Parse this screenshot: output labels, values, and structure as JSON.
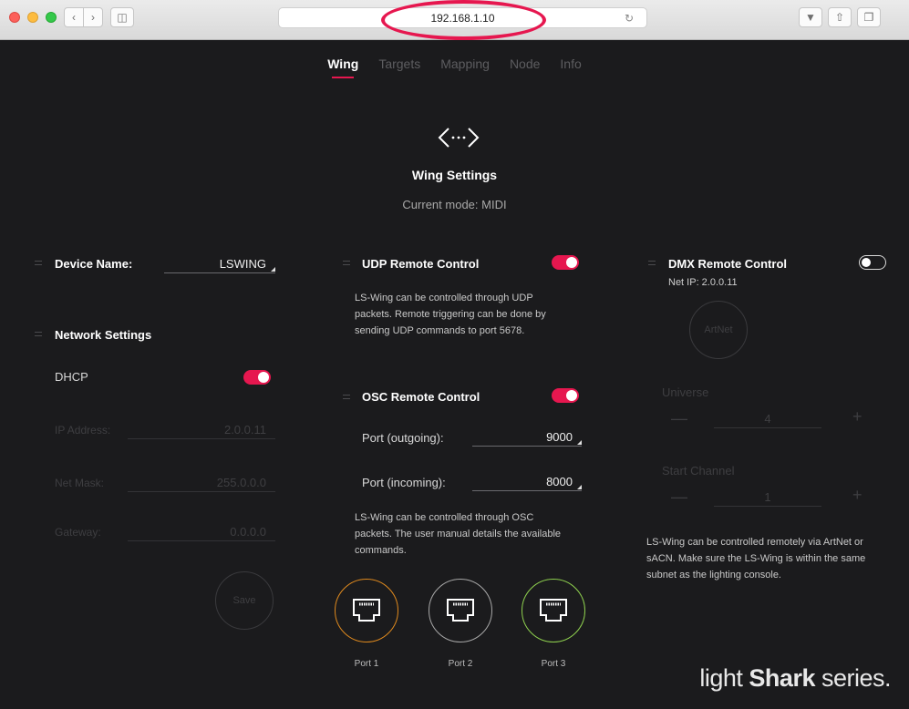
{
  "browser": {
    "url": "192.168.1.10"
  },
  "nav": {
    "tabs": [
      "Wing",
      "Targets",
      "Mapping",
      "Node",
      "Info"
    ],
    "active": "Wing"
  },
  "header": {
    "title": "Wing Settings",
    "mode": "Current mode: MIDI"
  },
  "left": {
    "device_name_label": "Device Name:",
    "device_name_value": "LSWING",
    "network_title": "Network Settings",
    "dhcp_label": "DHCP",
    "dhcp_on": true,
    "ip_label": "IP Address:",
    "ip_value": "2.0.0.11",
    "mask_label": "Net Mask:",
    "mask_value": "255.0.0.0",
    "gateway_label": "Gateway:",
    "gateway_value": "0.0.0.0",
    "save_label": "Save"
  },
  "middle": {
    "udp_title": "UDP Remote Control",
    "udp_on": true,
    "udp_desc": [
      "LS-Wing can be controlled through UDP",
      "packets. Remote triggering can be done by",
      "sending UDP commands to port 5678."
    ],
    "osc_title": "OSC Remote Control",
    "osc_on": true,
    "out_label": "Port (outgoing):",
    "out_value": "9000",
    "in_label": "Port (incoming):",
    "in_value": "8000",
    "osc_desc": [
      "LS-Wing can be controlled through OSC",
      "packets. The user manual details the available",
      "commands."
    ],
    "ports": [
      {
        "label": "Port 1",
        "color": "#e08a1e"
      },
      {
        "label": "Port 2",
        "color": "#a9a9a9"
      },
      {
        "label": "Port 3",
        "color": "#8fd14f"
      }
    ]
  },
  "right": {
    "dmx_title": "DMX Remote Control",
    "dmx_on": false,
    "net_ip": "Net IP: 2.0.0.11",
    "artnet_label": "ArtNet",
    "universe_label": "Universe",
    "universe_value": "4",
    "start_label": "Start Channel",
    "start_value": "1",
    "minus": "—",
    "plus": "+",
    "desc": [
      "LS-Wing can be controlled remotely via ArtNet or",
      "sACN. Make sure the LS-Wing is within the same",
      "subnet as the lighting console."
    ]
  },
  "brand": {
    "light": "light ",
    "shark": "Shark",
    "series": " series."
  },
  "colors": {
    "accent": "#e6174f",
    "background": "#1b1b1d"
  }
}
